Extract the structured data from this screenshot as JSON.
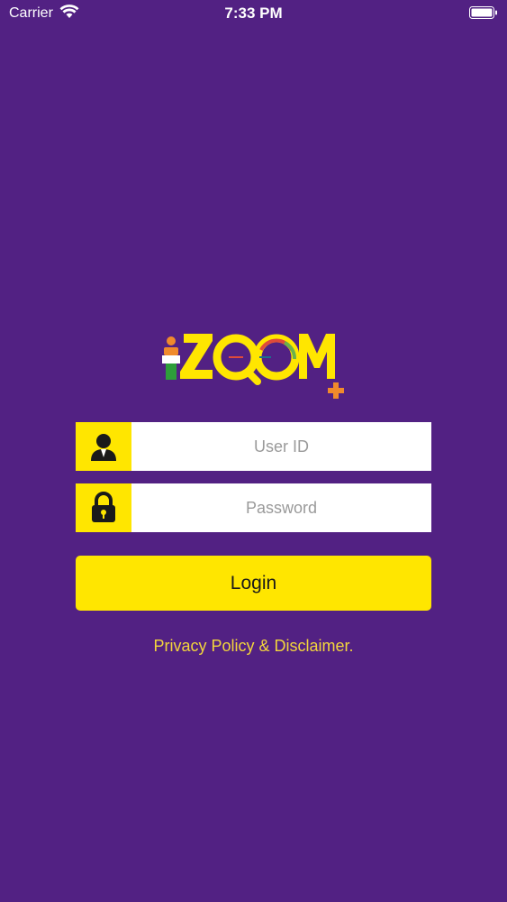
{
  "status_bar": {
    "carrier": "Carrier",
    "time": "7:33 PM"
  },
  "logo": {
    "text": "ZQOM"
  },
  "login_form": {
    "user_id_placeholder": "User ID",
    "password_placeholder": "Password",
    "login_label": "Login",
    "privacy_link": "Privacy Policy & Disclaimer."
  },
  "colors": {
    "background": "#522183",
    "accent_yellow": "#ffe600",
    "link": "#f2d53c"
  },
  "icons": [
    "wifi-icon",
    "battery-icon",
    "user-icon",
    "lock-icon"
  ]
}
